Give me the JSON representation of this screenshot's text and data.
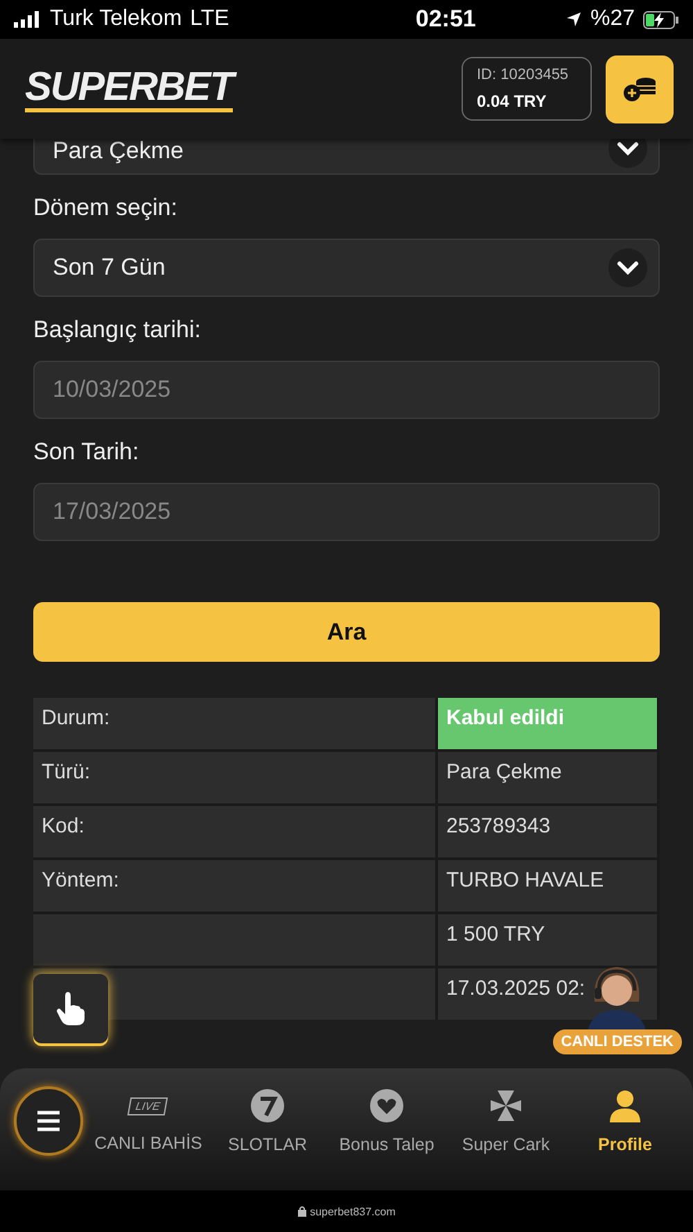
{
  "status_bar": {
    "carrier": "Turk Telekom",
    "network": "LTE",
    "time": "02:51",
    "battery": "%27"
  },
  "header": {
    "logo": "SUPERBET",
    "account_id": "ID: 10203455",
    "balance": "0.04 TRY"
  },
  "form": {
    "fields": [
      {
        "kind": "select",
        "value": "Para Çekme"
      },
      {
        "kind": "select",
        "label": "Dönem seçin:",
        "value": "Son 7 Gün"
      },
      {
        "kind": "date",
        "label": "Başlangıç tarihi:",
        "value": "10/03/2025",
        "disabled": true
      },
      {
        "kind": "date",
        "label": "Son Tarih:",
        "value": "17/03/2025",
        "disabled": true
      }
    ],
    "search_button": "Ara"
  },
  "details": [
    {
      "label": "Durum:",
      "value": "Kabul edildi",
      "status": true
    },
    {
      "label": "Türü:",
      "value": "Para Çekme",
      "status": false
    },
    {
      "label": "Kod:",
      "value": "253789343",
      "status": false
    },
    {
      "label": "Yöntem:",
      "value": "TURBO HAVALE",
      "status": false
    },
    {
      "value": "1 500 TRY",
      "status": false
    },
    {
      "value": "17.03.2025 02:",
      "status": false
    }
  ],
  "support_badge": "CANLI DESTEK",
  "bottom_nav": [
    {
      "kind": "live",
      "label": "CANLI BAHİS",
      "badge": "LIVE",
      "selected": false
    },
    {
      "kind": "slots",
      "label": "SLOTLAR",
      "selected": false
    },
    {
      "kind": "bonus",
      "label": "Bonus Talep",
      "selected": false
    },
    {
      "kind": "wheel",
      "label": "Super Cark",
      "selected": false
    },
    {
      "kind": "profile",
      "label": "Profile",
      "selected": true
    }
  ],
  "url_bar": "superbet837.com"
}
